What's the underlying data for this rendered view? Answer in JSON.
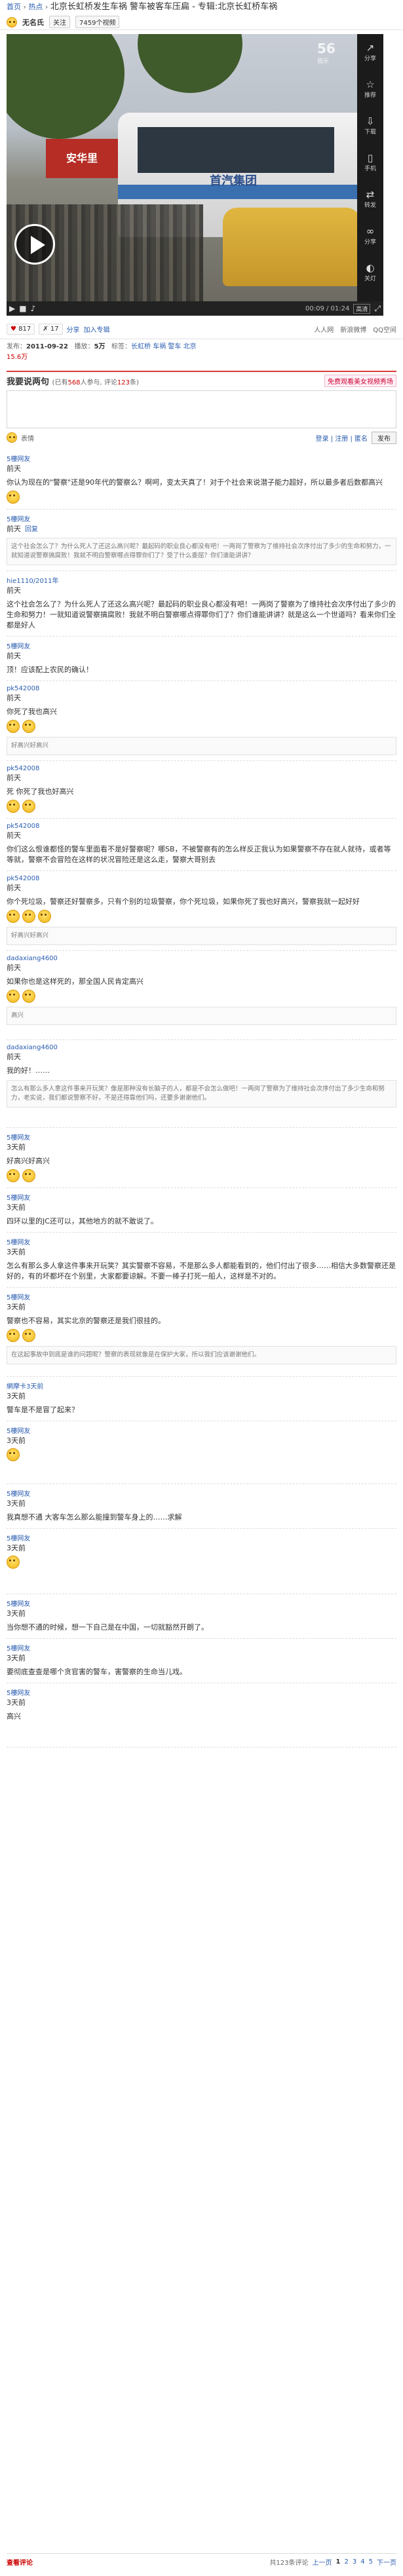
{
  "breadcrumb": {
    "home": "首页",
    "sep": "›",
    "channel": "热点",
    "title": "北京长虹桥发生车祸 警车被客车压扁 - 专辑:北京长虹桥车祸"
  },
  "subbar": {
    "user": "无名氏",
    "follow": "关注",
    "fans": "7459个视频"
  },
  "player": {
    "logo": "56",
    "logo_sub": "我乐",
    "sign_text": "安华里",
    "bus_name": "首汽集团",
    "side": [
      "分享",
      "推荐",
      "下载",
      "手机",
      "转发",
      "分享",
      "关灯"
    ],
    "time": "00:09 / 01:24",
    "quality": "高清",
    "progress": 0.11
  },
  "actions": {
    "likes": "817",
    "dislikes": "17",
    "share": "分享",
    "collect": "加入专辑",
    "right": [
      "人人网",
      "新浪微博",
      "QQ空间"
    ]
  },
  "meta": {
    "date_label": "发布：",
    "date": "2011-09-22",
    "views_label": "播放：",
    "views": "5万",
    "tags_label": "标签：",
    "tags": "长虹桥 车祸 警车 北京",
    "plays": "15.6万"
  },
  "comments_head": {
    "title": "我要说两句",
    "count_label": "(已有",
    "count": "568",
    "count_mid": "人参与, 评论",
    "count2": "123",
    "count_end": "条)",
    "promo": "免费观看美女视频秀场"
  },
  "editor": {
    "placeholder": "",
    "emoji_label": "表情",
    "login": "登录 | 注册 | 匿名",
    "send": "发布"
  },
  "comments": [
    {
      "user": "5樓网友",
      "time": "前天",
      "reply": "",
      "text": "你认为现在的\"警察\"还是90年代的警察么？啊呵，变太天真了！对于个社会来说潜子能力超好，所以最多者后数都高兴",
      "quote": ""
    },
    {
      "user": "5樓网友",
      "time": "前天",
      "reply": "回复",
      "text": "",
      "quote": "这个社会怎么了？为什么死人了还这么高兴呢？最起码的职业良心都没有吧！一两岗了警察为了维持社会次序付出了多少的生命和努力，一就知道说警察搞腐败！我就不明白警察哪点得罪你们了？受了什么委屈？你们谁能讲讲？"
    },
    {
      "user": "hie1110/2011年",
      "time": "前天",
      "reply": "",
      "text": "这个社会怎么了？为什么死人了还这么高兴呢？最起码的职业良心都没有吧！一两岗了警察为了维持社会次序付出了多少的生命和努力！一就知道说警察搞腐败！我就不明白警察哪点得罪你们了？你们谁能讲讲？就是这么一个世道吗？看来你们全都是好人",
      "quote": ""
    },
    {
      "user": "5樓网友",
      "time": "前天",
      "reply": "",
      "text": "顶！应该配上农民的确认！",
      "quote": ""
    },
    {
      "user": "pk542008",
      "time": "前天",
      "reply": "",
      "text": "你死了我也高兴",
      "quote": "好高兴好高兴"
    },
    {
      "user": "pk542008",
      "time": "前天",
      "reply": "",
      "text": "死 你死了我也好高兴",
      "quote": ""
    },
    {
      "user": "pk542008",
      "time": "前天",
      "reply": "",
      "text": "你们这么恨谁都怪的警车里面看不是好警察呢？哪SB，不被警察有的怎么样反正我认为如果警察不存在就人就待，或者等等就，警察不会冒险在这样的状况冒险还是这么走，警察大哥别去",
      "quote": ""
    },
    {
      "user": "pk542008",
      "time": "前天",
      "reply": "",
      "text": "你个死垃圾，警察还好警察多，只有个别的垃圾警察，你个死垃圾，如果你死了我也好高兴，警察我就一起好好",
      "quote": "好高兴好高兴"
    },
    {
      "user": "dadaxiang4600",
      "time": "前天",
      "reply": "",
      "text": "如果你也是这样死的，那全国人民肯定高兴",
      "quote": "高兴"
    },
    {
      "user": "dadaxiang4600",
      "time": "前天",
      "reply": "",
      "text": "我的好！……",
      "quote": "怎么有那么多人拿这件事来开玩笑？像是那种没有长脑子的人，都是不会怎么做吧！一两岗了警察为了维持社会次序付出了多少生命和努力，老实说，我们都说警察不好，不是还得靠他们吗，还要多谢谢他们。"
    },
    {
      "user": "5樓网友",
      "time": "3天前",
      "reply": "",
      "text": "好高兴好高兴",
      "quote": ""
    },
    {
      "user": "5樓网友",
      "time": "3天前",
      "reply": "",
      "text": "四环以里的JC还可以，其他地方的就不敢说了。",
      "quote": ""
    },
    {
      "user": "5樓网友",
      "time": "3天前",
      "reply": "",
      "text": "怎么有那么多人拿这件事来开玩笑？其实警察不容易，不是那么多人都能看到的，他们付出了很多……相信大多数警察还是好的，有的坏都坏在个别里，大家都要谅解。不要一棒子打死一船人，这样是不对的。",
      "quote": ""
    },
    {
      "user": "5樓网友",
      "time": "3天前",
      "reply": "",
      "text": "警察也不容易，其实北京的警察还是我们很挂的。",
      "quote": "在这起事故中到底是谁的问题呢？警察的表现就像是在保护大家，所以我们应该谢谢他们。"
    },
    {
      "user": "網摩卡3天前",
      "time": "3天前",
      "reply": "",
      "text": "警车是不是冒了起来？",
      "quote": ""
    },
    {
      "user": "5樓网友",
      "time": "3天前",
      "reply": "",
      "text": "",
      "quote": ""
    },
    {
      "user": "5樓网友",
      "time": "3天前",
      "reply": "",
      "text": "我真想不通 大客车怎么那么能撞到警车身上的……求解",
      "quote": ""
    },
    {
      "user": "5樓网友",
      "time": "3天前",
      "reply": "",
      "text": "",
      "quote": ""
    },
    {
      "user": "5樓网友",
      "time": "3天前",
      "reply": "",
      "text": "当你想不通的时候，想一下自己是在中国，一切就豁然开朗了。",
      "quote": ""
    },
    {
      "user": "5樓网友",
      "time": "3天前",
      "reply": "",
      "text": "要彻底查查是哪个贪官害的警车，害警察的生命当儿戏。",
      "quote": ""
    },
    {
      "user": "5樓网友",
      "time": "3天前",
      "reply": "",
      "text": "高兴",
      "quote": ""
    }
  ],
  "pagination": {
    "label": "查看评论",
    "total": "共123条评论",
    "pages": [
      "上一页",
      "1",
      "2",
      "3",
      "4",
      "5",
      "下一页"
    ]
  }
}
